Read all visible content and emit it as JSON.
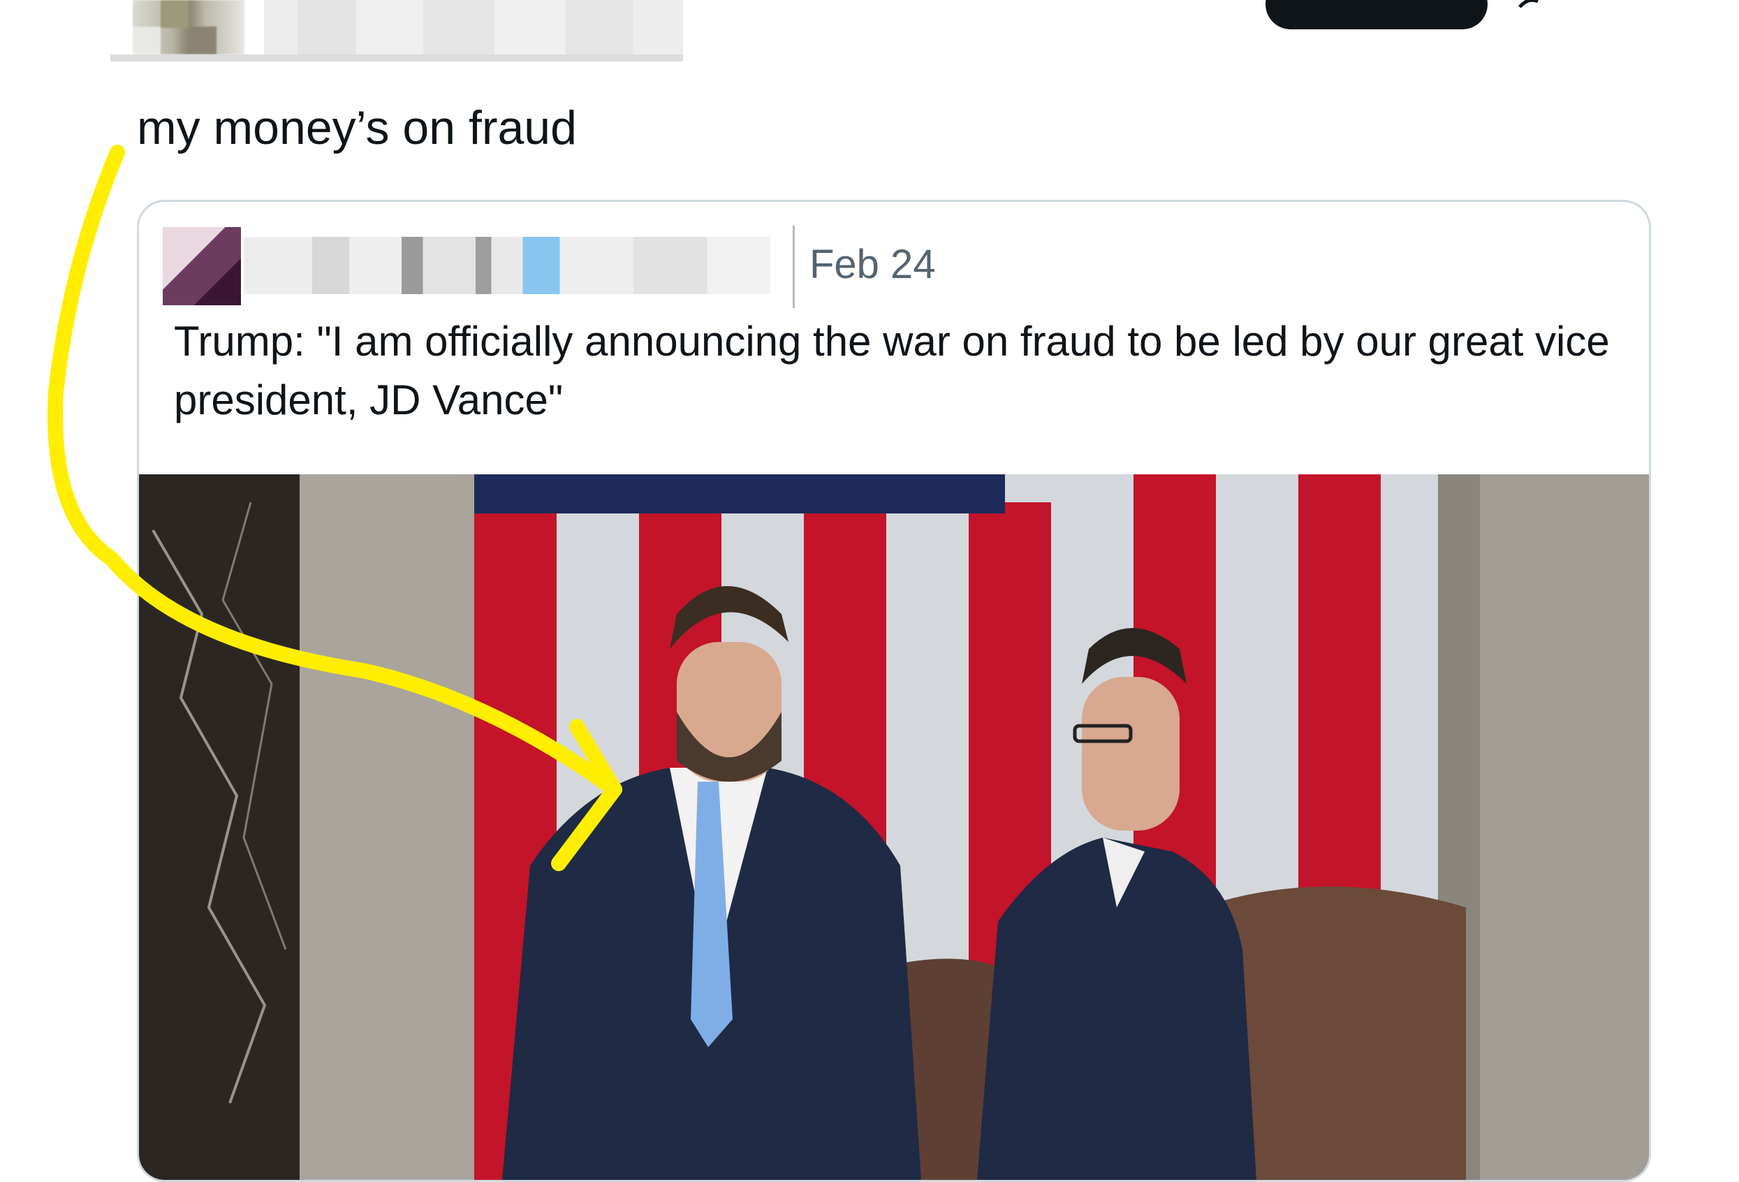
{
  "tweet": {
    "text": "my money’s on fraud"
  },
  "quoted_tweet": {
    "date": "Feb 24",
    "text": "Trump: \"I am officially announcing the war on fraud to be led by our great vice president, JD Vance\""
  },
  "colors": {
    "text_primary": "#0f1419",
    "text_secondary": "#536471",
    "card_border": "#cfd9de",
    "annotation": "#ffee00",
    "flag_red": "#c3142a",
    "flag_white": "#d4d8dc",
    "flag_blue": "#1d2a5a"
  },
  "icons": {
    "more": "more-options-icon",
    "arrow": "yellow-arrow-annotation"
  }
}
